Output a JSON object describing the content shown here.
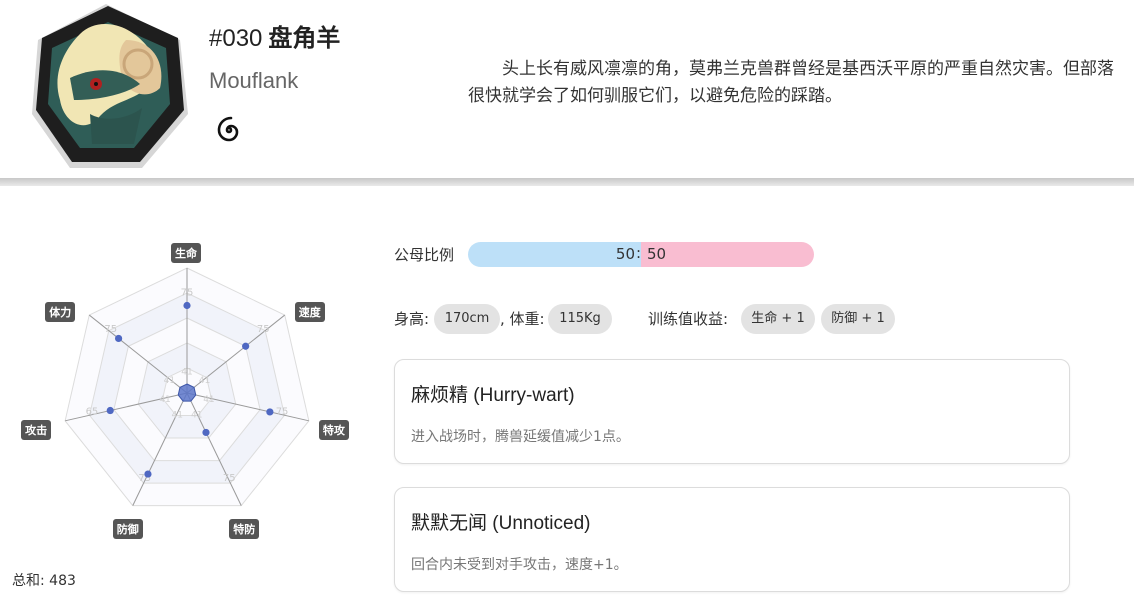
{
  "pokemon": {
    "number": "#030",
    "name_cn": "盘角羊",
    "name_en": "Mouflank",
    "type_icon": "spiral-icon",
    "description": "头上长有威风凛凛的角，莫弗兰克兽群曾经是基西沃平原的严重自然灾害。但部落很快就学会了如何驯服它们，以避免危险的踩踏。"
  },
  "stats": {
    "labels": [
      "生命",
      "速度",
      "特攻",
      "特防",
      "防御",
      "攻击",
      "体力"
    ],
    "ring_values": [
      "75",
      "75",
      "75",
      "75",
      "75",
      "65",
      "75"
    ],
    "inner_values": [
      "41",
      "41",
      "41",
      "41",
      "41",
      "41",
      "41"
    ],
    "values": [
      70,
      65,
      72,
      41,
      73,
      65,
      75
    ],
    "total_label": "总和: 483"
  },
  "gender": {
    "label": "公母比例",
    "male": "50",
    "separator": ":",
    "female": "50",
    "male_color": "#bde0f8",
    "female_color": "#f9bdd1"
  },
  "body": {
    "height_label": "身高:",
    "height": "170cm",
    "weight_label": ", 体重:",
    "weight": "115Kg",
    "ev_label": "训练值收益:",
    "ev": [
      "生命 + 1",
      "防御 + 1"
    ]
  },
  "abilities": [
    {
      "name": "麻烦精 (Hurry-wart)",
      "desc": "进入战场时，腾兽延缓值减少1点。"
    },
    {
      "name": "默默无闻 (Unnoticed)",
      "desc": "回合内未受到对手攻击，速度+1。"
    }
  ]
}
